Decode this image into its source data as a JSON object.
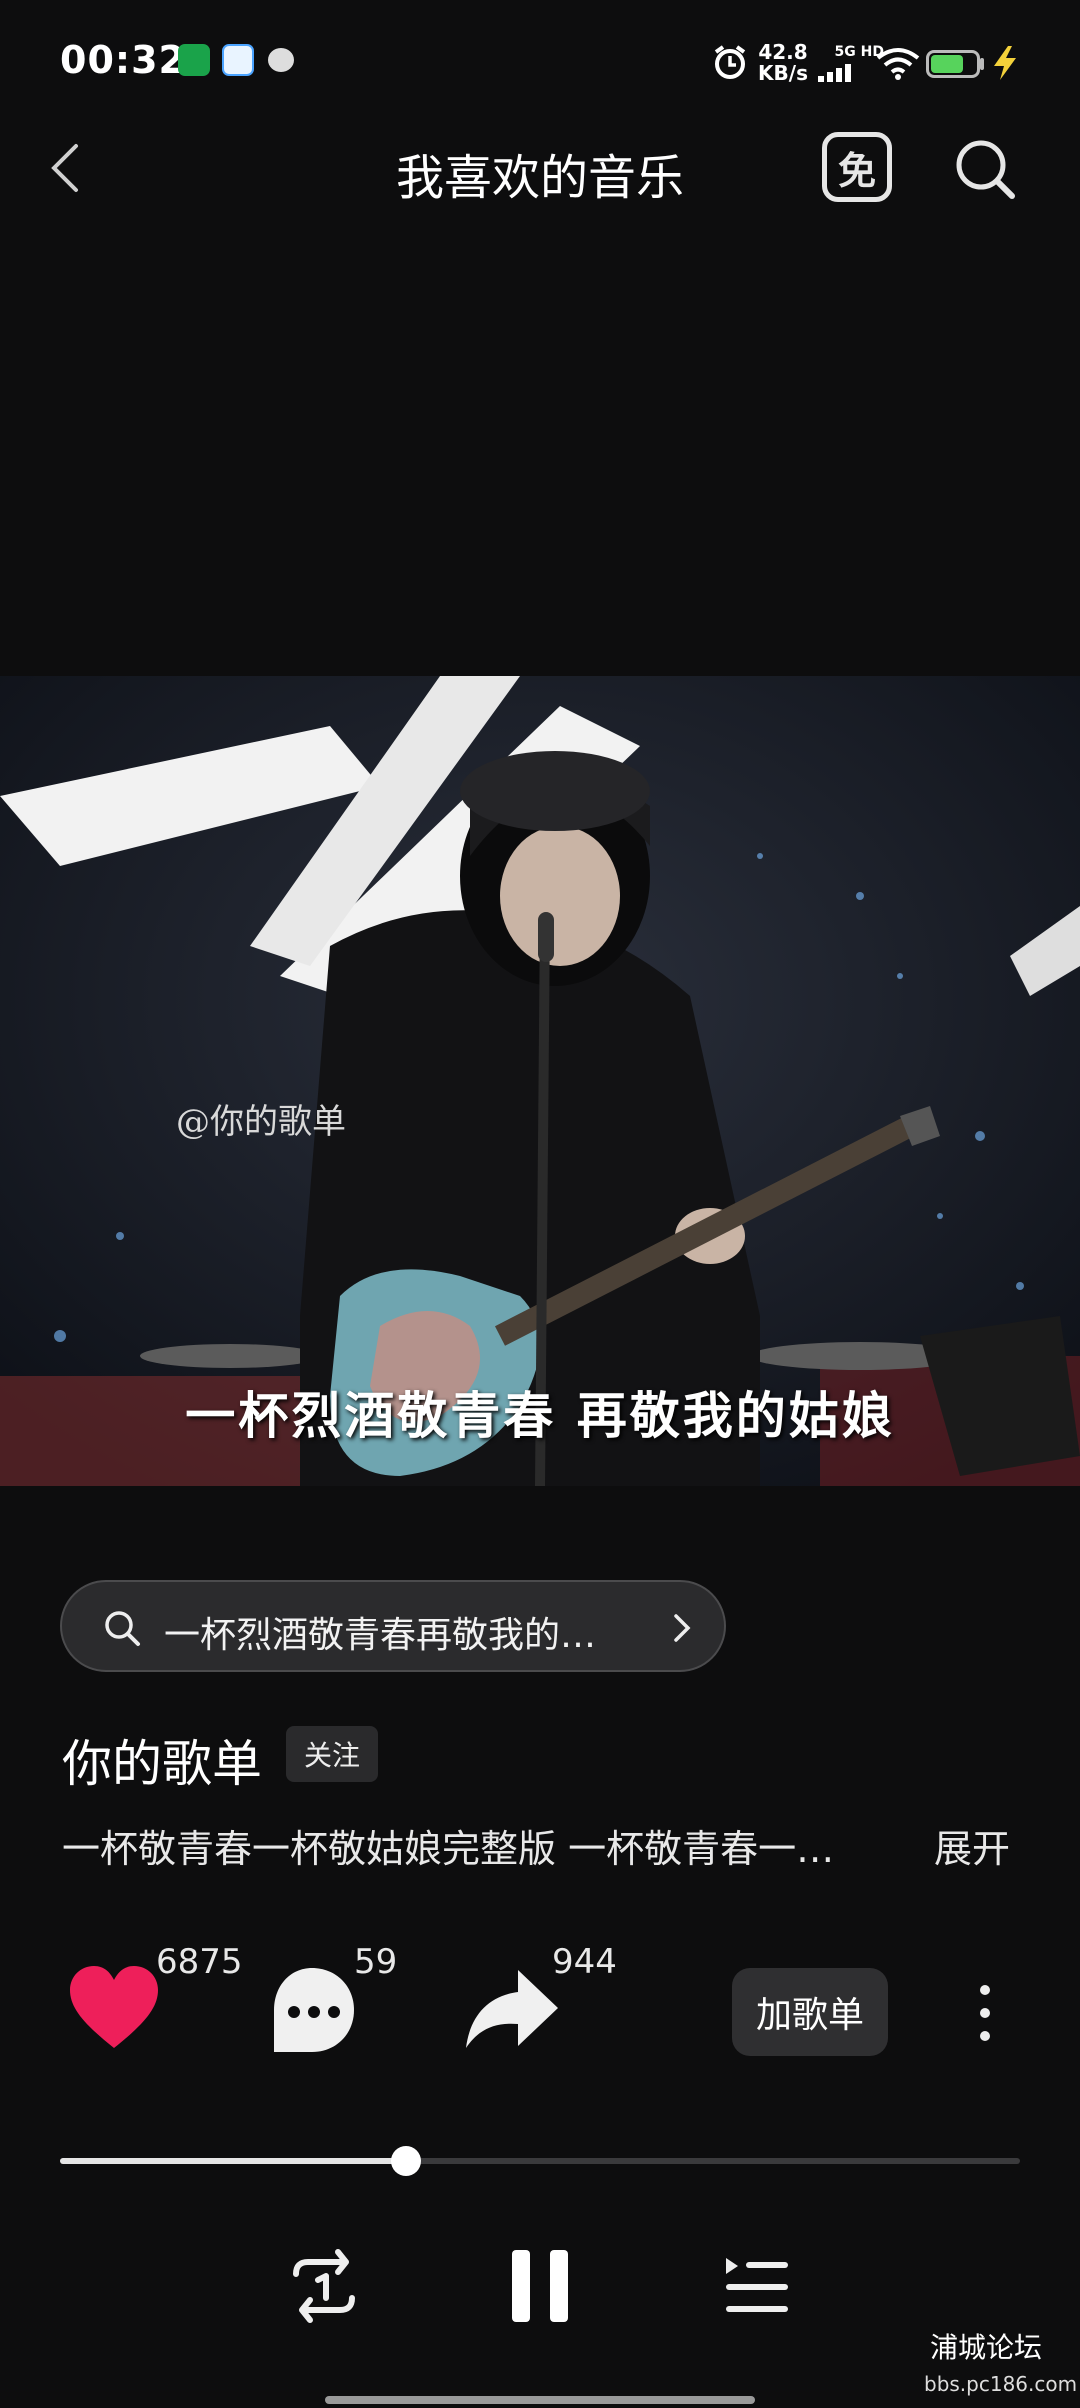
{
  "status_bar": {
    "time": "00:32",
    "net_speed_value": "42.8",
    "net_speed_unit": "KB/s",
    "network_label": "5G HD"
  },
  "header": {
    "title": "我喜欢的音乐",
    "free_badge": "免"
  },
  "video": {
    "watermark": "@你的歌单",
    "subtitle": "一杯烈酒敬青春 再敬我的姑娘"
  },
  "search_pill": {
    "text": "一杯烈酒敬青春再敬我的…"
  },
  "track": {
    "author": "你的歌单",
    "follow_label": "关注",
    "description": "一杯敬青春一杯敬姑娘完整版 一杯敬青春一…",
    "expand_label": "展开"
  },
  "actions": {
    "likes": "6875",
    "comments": "59",
    "shares": "944",
    "add_playlist_label": "加歌单"
  },
  "player": {
    "progress_fraction": 0.36
  },
  "forum": {
    "name": "浦城论坛",
    "url": "bbs.pc186.com"
  },
  "colors": {
    "like": "#ee1f5a",
    "accent_battery": "#57d35c",
    "charging": "#f3d13a"
  }
}
